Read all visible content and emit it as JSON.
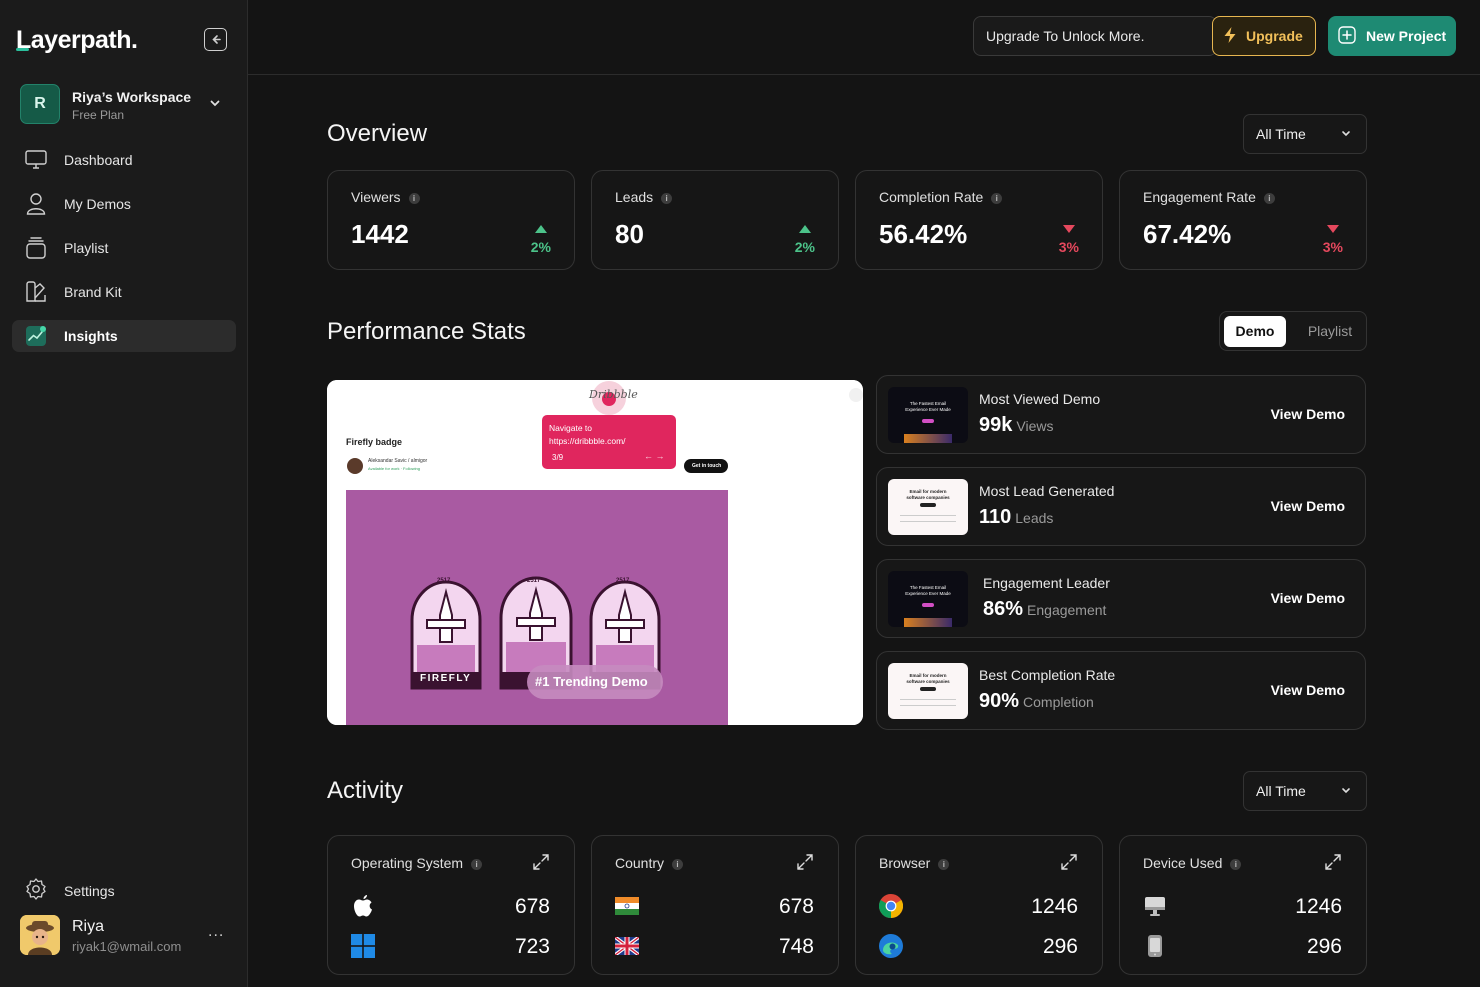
{
  "app": {
    "logo": "Layerpath."
  },
  "workspace": {
    "initial": "R",
    "name": "Riya’s Workspace",
    "plan": "Free Plan"
  },
  "nav": [
    {
      "label": "Dashboard",
      "icon": "monitor-icon"
    },
    {
      "label": "My Demos",
      "icon": "user-icon"
    },
    {
      "label": "Playlist",
      "icon": "playlist-icon"
    },
    {
      "label": "Brand Kit",
      "icon": "brand-kit-icon"
    },
    {
      "label": "Insights",
      "icon": "insights-icon",
      "active": true
    }
  ],
  "settings": {
    "label": "Settings"
  },
  "user": {
    "name": "Riya",
    "email": "riyak1@wmail.com",
    "more": "..."
  },
  "topbar": {
    "unlock_text": "Upgrade To Unlock More.",
    "upgrade_label": "Upgrade",
    "new_project_label": "New Project"
  },
  "overview": {
    "title": "Overview",
    "range": "All Time",
    "stats": [
      {
        "label": "Viewers",
        "value": "1442",
        "change": "2%",
        "trend": "up"
      },
      {
        "label": "Leads",
        "value": "80",
        "change": "2%",
        "trend": "up"
      },
      {
        "label": "Completion Rate",
        "value": "56.42%",
        "change": "3%",
        "trend": "down"
      },
      {
        "label": "Engagement Rate",
        "value": "67.42%",
        "change": "3%",
        "trend": "down"
      }
    ]
  },
  "performance": {
    "title": "Performance Stats",
    "toggle": {
      "active": "Demo",
      "inactive": "Playlist"
    },
    "preview": {
      "site_logo": "Dribbble",
      "heading": "Firefly badge",
      "author": "Aleksandar Savic / almigor",
      "author_status": "Available for work · Following",
      "tooltip_line1": "Navigate to",
      "tooltip_line2": "https://dribbble.com/",
      "tooltip_step": "3/9",
      "cta": "Get in touch",
      "badge_text": "FIREFLY",
      "badge_year": "2517",
      "trending_label": "#1 Trending Demo"
    },
    "items": [
      {
        "title": "Most Viewed Demo",
        "value": "99k",
        "unit": "Views",
        "action": "View Demo",
        "thumb": "dark"
      },
      {
        "title": "Most Lead Generated",
        "value": "110",
        "unit": "Leads",
        "action": "View Demo",
        "thumb": "light"
      },
      {
        "title": "Engagement Leader",
        "value": "86%",
        "unit": "Engagement",
        "action": "View Demo",
        "thumb": "dark"
      },
      {
        "title": "Best Completion Rate",
        "value": "90%",
        "unit": "Completion",
        "action": "View Demo",
        "thumb": "light"
      }
    ],
    "thumb_text_dark": "The Fastest Email Experience Ever Made",
    "thumb_text_light": "Email for modern software companies"
  },
  "activity": {
    "title": "Activity",
    "range": "All Time",
    "cards": [
      {
        "label": "Operating System",
        "rows": [
          {
            "icon": "apple-icon",
            "value": "678"
          },
          {
            "icon": "windows-icon",
            "value": "723"
          }
        ]
      },
      {
        "label": "Country",
        "rows": [
          {
            "icon": "india-flag-icon",
            "value": "678"
          },
          {
            "icon": "uk-flag-icon",
            "value": "748"
          }
        ]
      },
      {
        "label": "Browser",
        "rows": [
          {
            "icon": "chrome-icon",
            "value": "1246"
          },
          {
            "icon": "edge-icon",
            "value": "296"
          }
        ]
      },
      {
        "label": "Device Used",
        "rows": [
          {
            "icon": "desktop-icon",
            "value": "1246"
          },
          {
            "icon": "mobile-icon",
            "value": "296"
          }
        ]
      }
    ]
  },
  "colors": {
    "accent": "#1e8a73",
    "upgrade": "#f2c05a",
    "up": "#4cc38a",
    "down": "#e5485d",
    "background": "#141414"
  }
}
